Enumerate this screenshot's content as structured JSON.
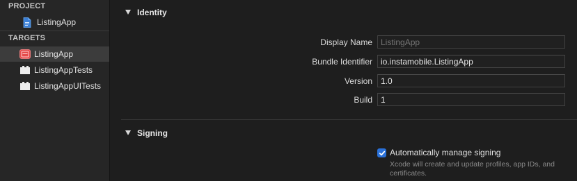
{
  "sidebar": {
    "project_header": "PROJECT",
    "project_item": {
      "label": "ListingApp",
      "icon": "project-file-icon"
    },
    "targets_header": "TARGETS",
    "targets": [
      {
        "label": "ListingApp",
        "icon": "app-target-icon",
        "selected": true
      },
      {
        "label": "ListingAppTests",
        "icon": "test-bundle-icon",
        "selected": false
      },
      {
        "label": "ListingAppUITests",
        "icon": "test-bundle-icon",
        "selected": false
      }
    ]
  },
  "identity": {
    "title": "Identity",
    "display_name_label": "Display Name",
    "display_name_placeholder": "ListingApp",
    "bundle_id_label": "Bundle Identifier",
    "bundle_id_value": "io.instamobile.ListingApp",
    "version_label": "Version",
    "version_value": "1.0",
    "build_label": "Build",
    "build_value": "1"
  },
  "signing": {
    "title": "Signing",
    "auto_manage_label": "Automatically manage signing",
    "auto_manage_checked": true,
    "auto_manage_description": "Xcode will create and update profiles, app IDs, and certificates."
  },
  "colors": {
    "accent": "#2a71d9",
    "app_icon": "#e54b4b"
  }
}
